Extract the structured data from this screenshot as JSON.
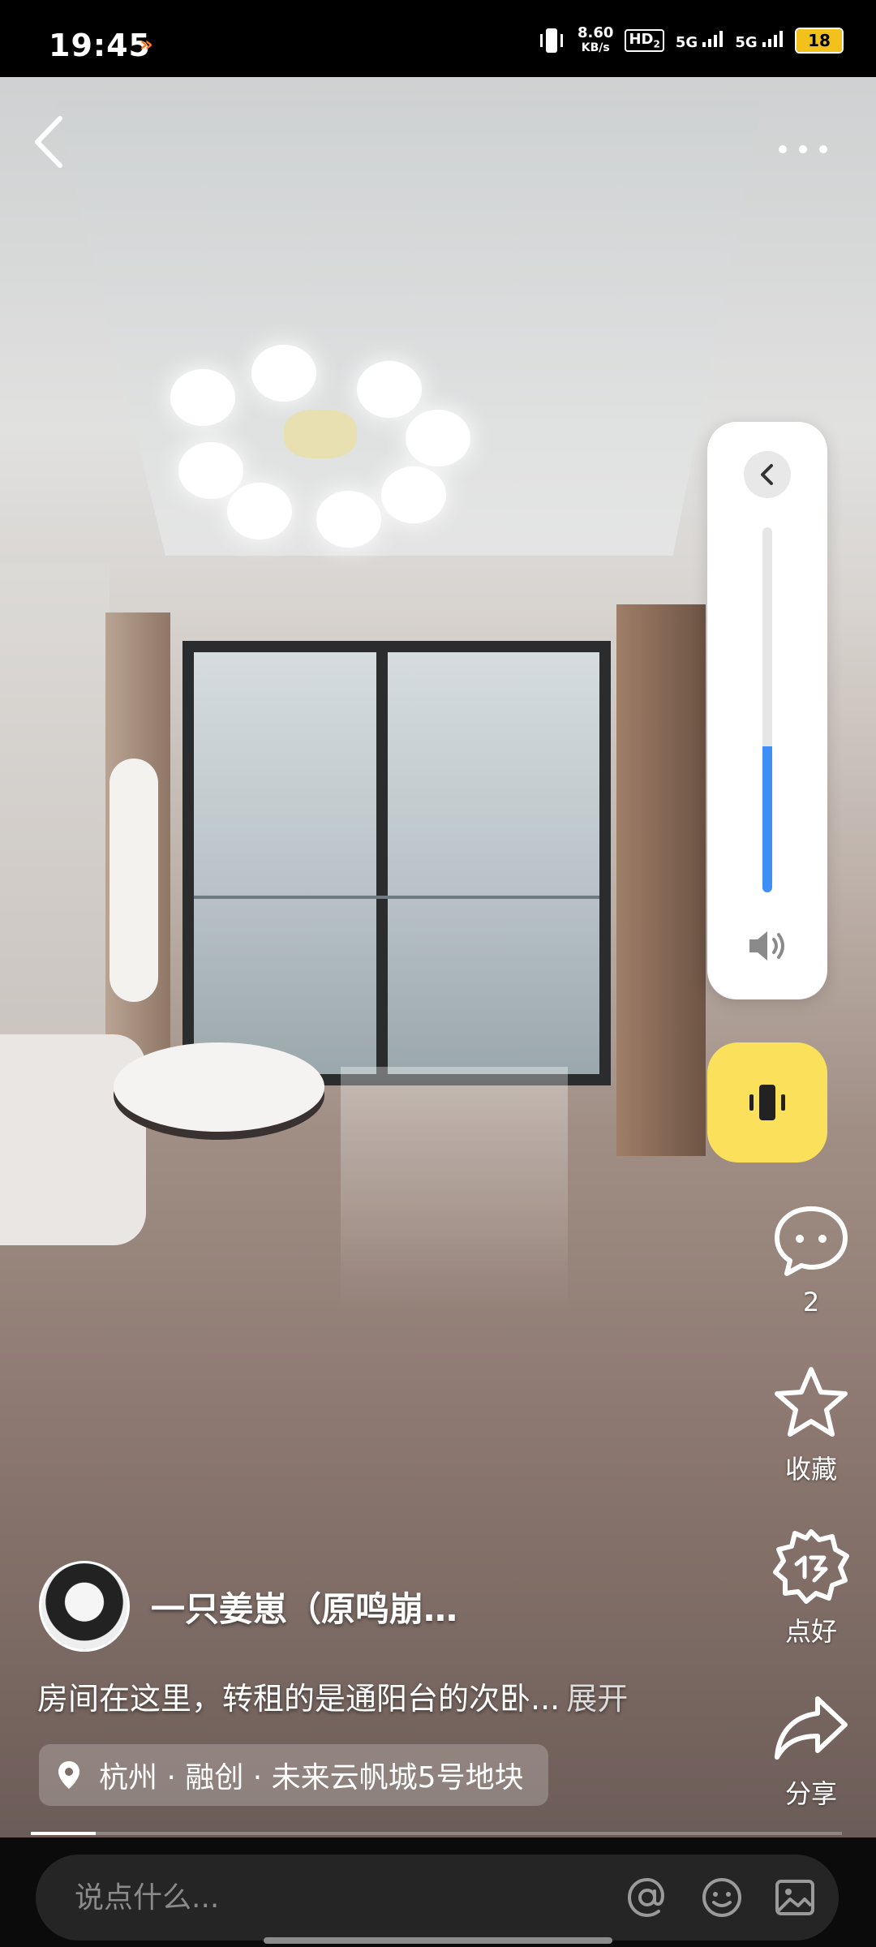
{
  "status_bar": {
    "time": "19:45",
    "net_speed_value": "8.60",
    "net_speed_unit": "KB/s",
    "hd_label": "HD",
    "hd_sub": "2",
    "signal_1": "5G",
    "signal_2": "5G",
    "battery": "18"
  },
  "post": {
    "author_name": "一只姜崽（原鸣崩…",
    "caption": "房间在这里，转租的是通阳台的次卧...",
    "expand_label": "展开",
    "location": "杭州 · 融创 · 未来云帆城5号地块"
  },
  "volume": {
    "level_fraction": 0.4
  },
  "actions": {
    "comment_count": "2",
    "favorite_label": "收藏",
    "like_label": "点好",
    "share_label": "分享"
  },
  "video": {
    "progress_fraction": 0.08
  },
  "comment_bar": {
    "placeholder": "说点什么..."
  },
  "colors": {
    "accent_yellow": "#fbe15b",
    "volume_blue": "#3d8ff5",
    "brand_orange": "#ff7a1a"
  }
}
